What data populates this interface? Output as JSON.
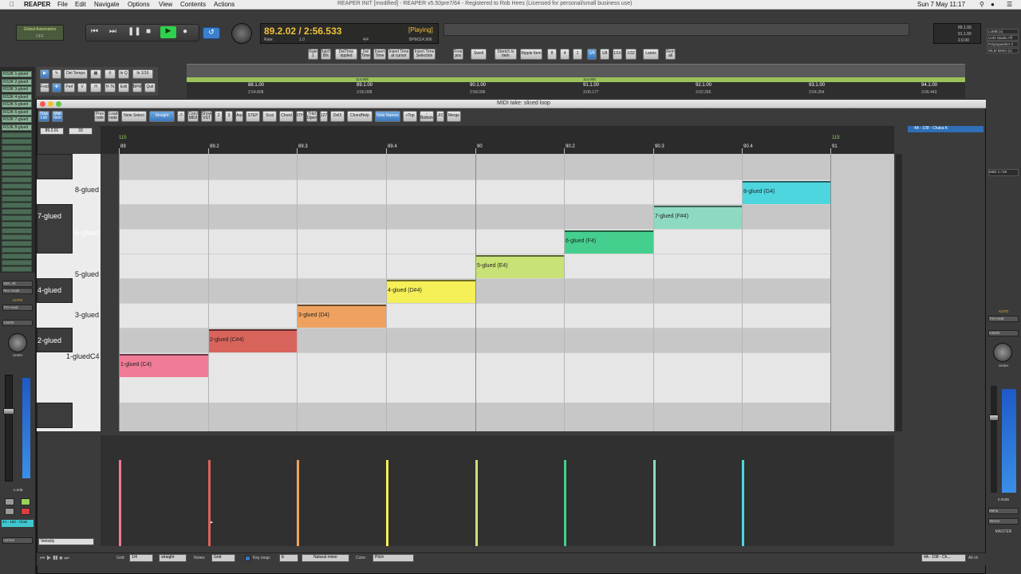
{
  "menubar": {
    "items": [
      "REAPER",
      "File",
      "Edit",
      "Navigate",
      "Options",
      "View",
      "Contents",
      "Actions"
    ],
    "title": "REAPER INIT [modified] - REAPER v5.50pre7/64 - Registered to Rob Hees (Licensed for personal/small business use)",
    "clock": "Sun 7 May  11:17"
  },
  "transport": {
    "auto_title": "Global Automation",
    "auto_val": "OFF",
    "time": "89.2.02 / 2:56.533",
    "status": "[Playing]",
    "rate_lbl": "Rate:",
    "rate_val": "1.0",
    "sig": "4/4",
    "bpm": "BPM114.906",
    "right_vals": [
      "89.1.00",
      "91.1.00",
      "2.0.00"
    ]
  },
  "tracks": [
    "RS3K 1-glued",
    "RS3K 2-glued",
    "RS3K 3-glued",
    "RS3K 4-glued",
    "RS3K 5-glued",
    "RS3K 6-glued",
    "RS3K 7-glued",
    "RS3K 8-glued"
  ],
  "right_panel": [
    "LoMB (x)",
    "UAD Studio Aff",
    "Polysquasher 2",
    "WLM Meter (x)"
  ],
  "toolbar_main": [
    "Rate\n1",
    "Batch\nBfx",
    "DelTime\nrippled",
    "Del\nTime",
    "Insert\nTime",
    "Insert Time\nat cursor",
    "Insert Time\nSelection",
    "Free\npos",
    "Swell",
    "Stretch to\nitem",
    "Ripple Item",
    "8",
    "4",
    "1",
    "1/4",
    "1/8",
    "1/16",
    "1/32",
    "Lanes",
    "Rem\nall"
  ],
  "left_tools": [
    "Del Tempo",
    "In Q",
    "In 1/16",
    "Fold",
    "Perf",
    "V",
    "H",
    "H-Tk",
    "Edit",
    "BPM",
    "Quit"
  ],
  "timeline": {
    "marks": [
      "88.1.00",
      "89.1.00",
      "90.1.00",
      "91.1.00",
      "92.1.00",
      "93.1.00",
      "94.1.00"
    ],
    "times": [
      "2:54.808",
      "2:56.008",
      "2:58.096",
      "3:00.177",
      "3:02.265",
      "3:04.354",
      "3:06.443"
    ],
    "tempo": [
      "114.906",
      "114.906"
    ]
  },
  "midi_editor": {
    "title": "MIDI take: sliced loop",
    "pos": "89.2.01",
    "len": "33",
    "tool_buttons": [
      "Trax\nList",
      "Midi\nItem",
      "Prev\nnote",
      "Load\nnote",
      "Note Select",
      "Straight",
      "-7-",
      "Conv\nMIDI",
      "Show\nVST",
      "2",
      "3",
      "Arp",
      "STEP",
      "Scal",
      "Chord",
      "STH",
      "Trkd\nOpen",
      "127",
      "Del3",
      "ChordHelp",
      "Note Names",
      "+Top",
      "-Bottom",
      "LFO",
      "Merge"
    ],
    "tempo_marks": [
      "115",
      "115"
    ],
    "bars": [
      "89",
      "89.2",
      "89.3",
      "89.4",
      "90",
      "90.2",
      "90.3",
      "90.4",
      "91"
    ],
    "keys": [
      {
        "label": "8-glued",
        "dark": false
      },
      {
        "label": "7-glued",
        "dark": true
      },
      {
        "label": "6-glued",
        "dark": true
      },
      {
        "label": "5-glued",
        "dark": false
      },
      {
        "label": "4-glued",
        "dark": true
      },
      {
        "label": "3-glued",
        "dark": false
      },
      {
        "label": "2-glued",
        "dark": true
      },
      {
        "label": "1-gluedC4",
        "dark": false
      }
    ],
    "notes": [
      "1-glued (C4)",
      "2-glued (C#4)",
      "3-glued (D4)",
      "4-glued (D#4)",
      "5-glued (E4)",
      "6-glued (F4)",
      "7-glued (F#4)",
      "8-glued (G4)"
    ],
    "note_colors": [
      "#ef7b97",
      "#d9645c",
      "#efa25f",
      "#f5ef58",
      "#c9e275",
      "#45cf8e",
      "#8ed9c2",
      "#4ed6df"
    ],
    "lane_select": "Velocity",
    "bottom": {
      "grid_lbl": "Grid:",
      "grid_val": "1/4",
      "swing": "straight",
      "notes_lbl": "Notes:",
      "notes_val": "Grid",
      "keysnap": "Key snap:",
      "key_val": "E",
      "scale": "Natural minor",
      "color_lbl": "Color:",
      "color_val": "Pitch"
    },
    "right_track": "4A - 108 - Chaka K"
  },
  "mixer_left": {
    "fx": "MIX: All:",
    "mode": "Rec mode",
    "auto": "AUTO",
    "trim": "Trm-read",
    "inserts": "Inserts",
    "pan": "center",
    "db": "-1.0dB",
    "name": "4A - 108 - Chak",
    "route": "normal"
  },
  "mixer_right": {
    "auto": "AUTO",
    "trim": "Trm-read",
    "inserts": "Inserts",
    "pan": "center",
    "db": "0.00dB",
    "menu": "Menu",
    "stereo": "Stereo",
    "master": "MASTER",
    "midi": "MIDI 1 / MI",
    "statusbar": "4A - 108 - Ch...",
    "all": "All ch"
  }
}
